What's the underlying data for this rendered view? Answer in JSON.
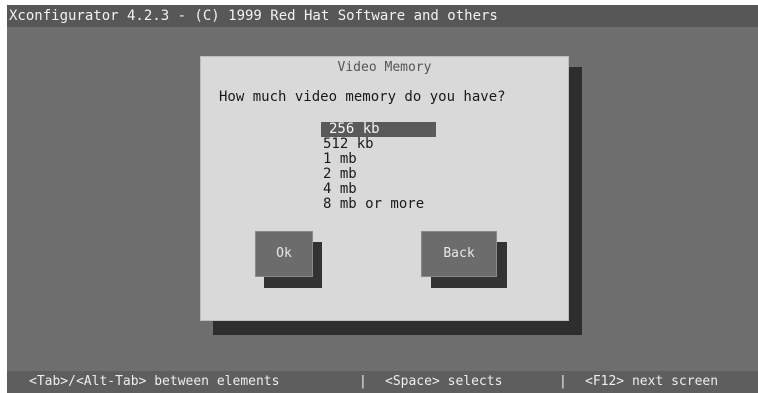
{
  "window": {
    "title": "Xconfigurator 4.2.3 - (C) 1999 Red Hat Software and others"
  },
  "dialog": {
    "title": "Video Memory",
    "question": "How much video memory do you have?",
    "options": [
      "256 kb",
      "512 kb",
      "1 mb",
      "2 mb",
      "4 mb",
      "8 mb or more"
    ],
    "selected_index": 0,
    "buttons": {
      "ok": "Ok",
      "back": "Back"
    }
  },
  "status_bar": {
    "tab_hint": "<Tab>/<Alt-Tab> between elements",
    "separator": "|",
    "space_hint": "<Space> selects",
    "f12_hint": "<F12> next screen"
  }
}
